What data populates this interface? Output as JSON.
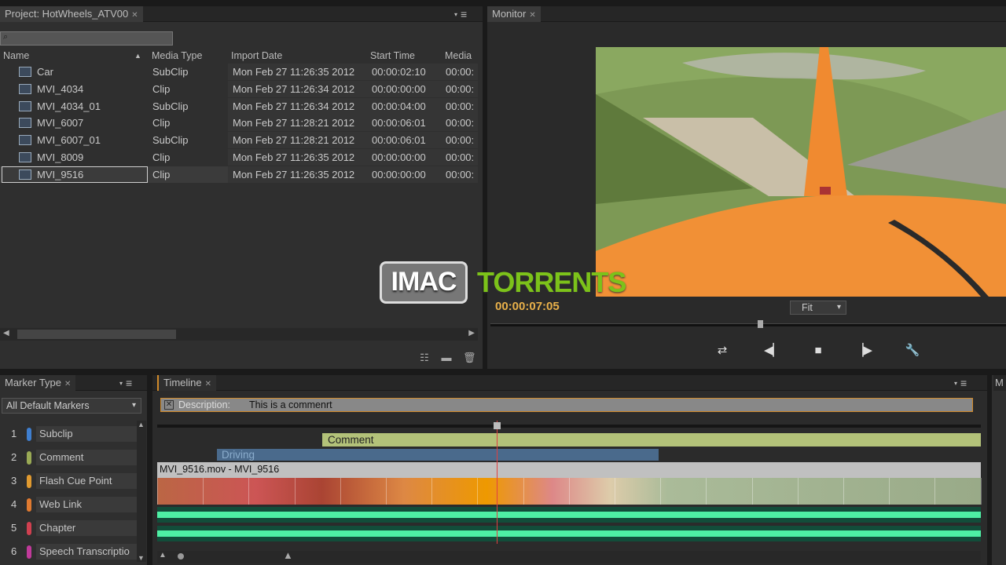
{
  "project": {
    "tab": "Project: HotWheels_ATV00",
    "columns": {
      "name": "Name",
      "media_type": "Media Type",
      "import_date": "Import Date",
      "start_time": "Start Time",
      "media": "Media"
    },
    "rows": [
      {
        "name": "Car",
        "type": "SubClip",
        "date": "Mon Feb 27 11:26:35 2012",
        "start": "00:00:02:10",
        "media": "00:00:"
      },
      {
        "name": "MVI_4034",
        "type": "Clip",
        "date": "Mon Feb 27 11:26:34 2012",
        "start": "00:00:00:00",
        "media": "00:00:"
      },
      {
        "name": "MVI_4034_01",
        "type": "SubClip",
        "date": "Mon Feb 27 11:26:34 2012",
        "start": "00:00:04:00",
        "media": "00:00:"
      },
      {
        "name": "MVI_6007",
        "type": "Clip",
        "date": "Mon Feb 27 11:28:21 2012",
        "start": "00:00:06:01",
        "media": "00:00:"
      },
      {
        "name": "MVI_6007_01",
        "type": "SubClip",
        "date": "Mon Feb 27 11:28:21 2012",
        "start": "00:00:06:01",
        "media": "00:00:"
      },
      {
        "name": "MVI_8009",
        "type": "Clip",
        "date": "Mon Feb 27 11:26:35 2012",
        "start": "00:00:00:00",
        "media": "00:00:"
      },
      {
        "name": "MVI_9516",
        "type": "Clip",
        "date": "Mon Feb 27 11:26:35 2012",
        "start": "00:00:00:00",
        "media": "00:00:"
      }
    ]
  },
  "monitor": {
    "tab": "Monitor",
    "timecode": "00:00:07:05",
    "fit": "Fit"
  },
  "watermark": {
    "left": "IMAC",
    "right": "TORRENTS"
  },
  "marker_panel": {
    "tab": "Marker Type",
    "filter": "All Default Markers",
    "types": [
      {
        "num": "1",
        "label": "Subclip",
        "color": "#3f7fd0"
      },
      {
        "num": "2",
        "label": "Comment",
        "color": "#9aaa55"
      },
      {
        "num": "3",
        "label": "Flash Cue Point",
        "color": "#e09a30"
      },
      {
        "num": "4",
        "label": "Web Link",
        "color": "#e07a30"
      },
      {
        "num": "5",
        "label": "Chapter",
        "color": "#d04050"
      },
      {
        "num": "6",
        "label": "Speech Transcriptio",
        "color": "#c03a9a"
      }
    ]
  },
  "timeline": {
    "tab": "Timeline",
    "description_label": "Description:",
    "description_value": "This is a commenrt",
    "marker_comment": "Comment",
    "marker_driving": "Driving",
    "clip_label": "MVI_9516.mov - MVI_9516"
  },
  "right_panel": {
    "tab": "M"
  }
}
